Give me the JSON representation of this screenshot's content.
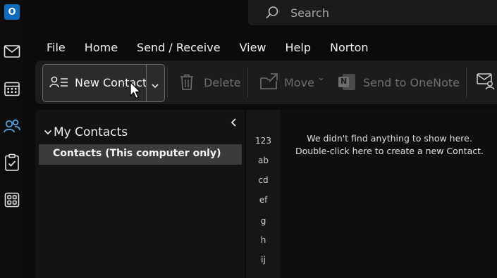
{
  "app": {
    "logo_letter": "O"
  },
  "search": {
    "placeholder": "Search"
  },
  "menu": {
    "tabs": [
      "File",
      "Home",
      "Send / Receive",
      "View",
      "Help",
      "Norton"
    ],
    "active": "Home"
  },
  "ribbon": {
    "new_contact": "New Contact",
    "delete": "Delete",
    "move": "Move",
    "move_arrow": "⌄",
    "onenote": "Send to OneNote",
    "onenote_letter": "N"
  },
  "folders": {
    "group_label": "My Contacts",
    "selected": "Contacts (This computer only)"
  },
  "index": [
    "123",
    "ab",
    "cd",
    "ef",
    "g",
    "h",
    "ij"
  ],
  "empty": {
    "line1": "We didn't find anything to show here.",
    "line2": "Double-click here to create a new Contact."
  },
  "colors": {
    "accent": "#4f9de8",
    "outlook_blue": "#0f6cbd"
  }
}
